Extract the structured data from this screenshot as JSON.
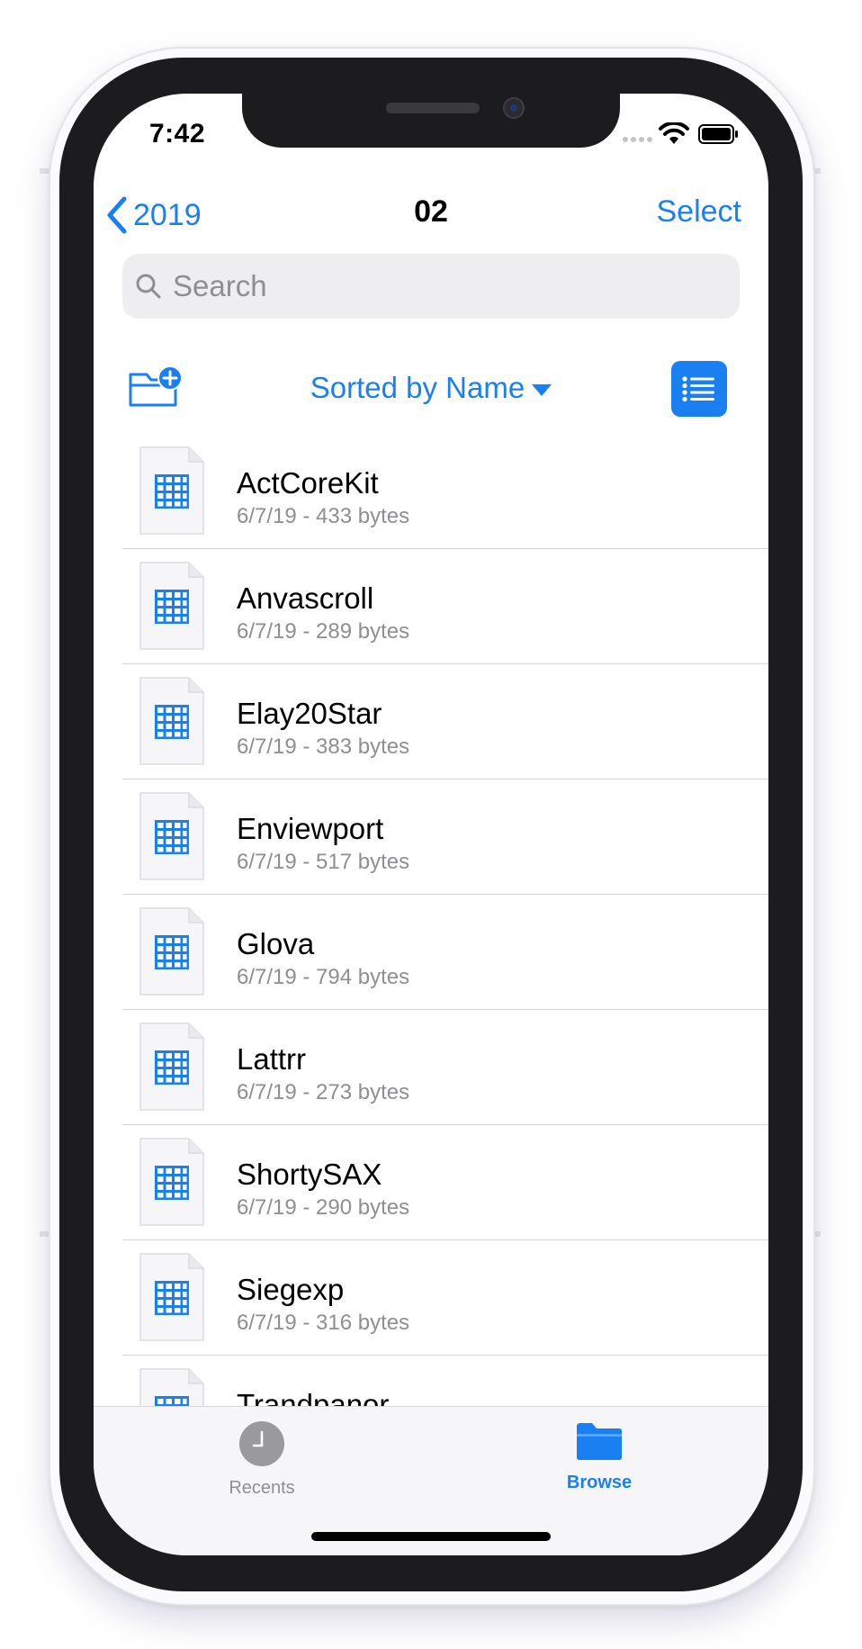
{
  "status_bar": {
    "time": "7:42",
    "icons": [
      "cellular-dots-icon",
      "wifi-icon",
      "battery-icon"
    ]
  },
  "nav": {
    "back_label": "2019",
    "title": "02",
    "select_label": "Select"
  },
  "search": {
    "placeholder": "Search",
    "value": ""
  },
  "toolbar": {
    "sort_label": "Sorted by Name",
    "icons": [
      "new-folder-icon",
      "caret-down-icon",
      "list-view-icon"
    ]
  },
  "files": [
    {
      "name": "ActCoreKit",
      "meta": "6/7/19 - 433 bytes"
    },
    {
      "name": "Anvascroll",
      "meta": "6/7/19 - 289 bytes"
    },
    {
      "name": "Elay20Star",
      "meta": "6/7/19 - 383 bytes"
    },
    {
      "name": "Enviewport",
      "meta": "6/7/19 - 517 bytes"
    },
    {
      "name": "Glova",
      "meta": "6/7/19 - 794 bytes"
    },
    {
      "name": "Lattrr",
      "meta": "6/7/19 - 273 bytes"
    },
    {
      "name": "ShortySAX",
      "meta": "6/7/19 - 290 bytes"
    },
    {
      "name": "Siegexp",
      "meta": "6/7/19 - 316 bytes"
    },
    {
      "name": "Trandpanor",
      "meta": ""
    }
  ],
  "tabs": {
    "recents_label": "Recents",
    "browse_label": "Browse",
    "selected": "Browse"
  },
  "colors": {
    "accent": "#1a7ff1",
    "secondary_text": "#8e8e93",
    "bezel": "#1c1c1e"
  }
}
